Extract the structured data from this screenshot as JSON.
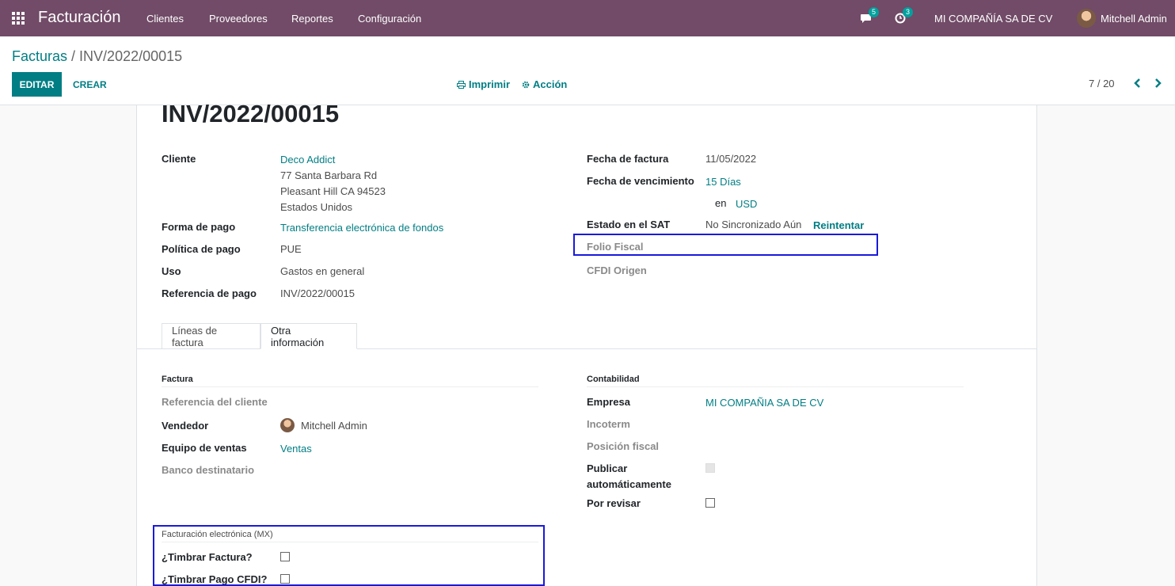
{
  "navbar": {
    "app_title": "Facturación",
    "menu": [
      "Clientes",
      "Proveedores",
      "Reportes",
      "Configuración"
    ],
    "messages_count": "5",
    "activities_count": "3",
    "company": "MI COMPAÑÍA SA DE CV",
    "user": "Mitchell Admin"
  },
  "breadcrumb": {
    "parent": "Facturas",
    "separator": " / ",
    "current": "INV/2022/00015"
  },
  "actions": {
    "edit": "EDITAR",
    "create": "CREAR",
    "print": "Imprimir",
    "action": "Acción"
  },
  "pager": {
    "value": "7 / 20"
  },
  "record": {
    "title": "INV/2022/00015",
    "left": {
      "customer_label": "Cliente",
      "customer_name": "Deco Addict",
      "address_line1": "77 Santa Barbara Rd",
      "address_line2": "Pleasant Hill CA 94523",
      "address_line3": "Estados Unidos",
      "payment_form_label": "Forma de pago",
      "payment_form": "Transferencia electrónica de fondos",
      "payment_policy_label": "Política de pago",
      "payment_policy": "PUE",
      "usage_label": "Uso",
      "usage": "Gastos en general",
      "payment_ref_label": "Referencia de pago",
      "payment_ref": "INV/2022/00015"
    },
    "right": {
      "invoice_date_label": "Fecha de factura",
      "invoice_date": "11/05/2022",
      "due_date_label": "Fecha de vencimiento",
      "due_date": "15 Días",
      "currency_prefix": "en",
      "currency": "USD",
      "sat_status_label": "Estado en el SAT",
      "sat_status": "No Sincronizado Aún",
      "retry": "Reintentar",
      "folio_fiscal_label": "Folio Fiscal",
      "cfdi_origin_label": "CFDI Origen"
    }
  },
  "tabs": [
    "Líneas de factura",
    "Otra información"
  ],
  "other_info": {
    "invoice_section": "Factura",
    "customer_ref_label": "Referencia del cliente",
    "salesperson_label": "Vendedor",
    "salesperson": "Mitchell Admin",
    "sales_team_label": "Equipo de ventas",
    "sales_team": "Ventas",
    "bank_label": "Banco destinatario",
    "accounting_section": "Contabilidad",
    "company_label": "Empresa",
    "company": "MI COMPAÑIA SA DE CV",
    "incoterm_label": "Incoterm",
    "fiscal_position_label": "Posición fiscal",
    "auto_post_label_1": "Publicar",
    "auto_post_label_2": "automáticamente",
    "to_check_label": "Por revisar",
    "edi_section": "Facturación electrónica (MX)",
    "stamp_invoice_label": "¿Timbrar Factura?",
    "stamp_payment_label": "¿Timbrar Pago CFDI?"
  }
}
